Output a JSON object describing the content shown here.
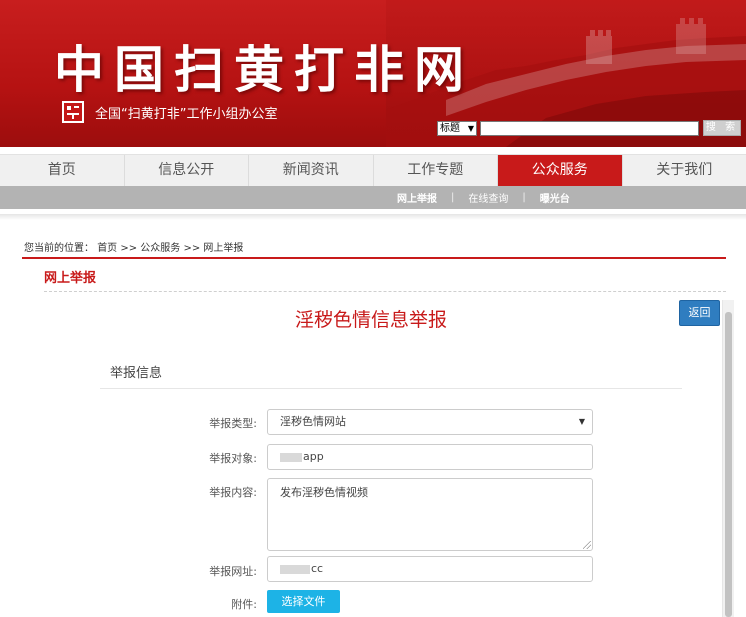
{
  "header": {
    "site_title": "中国扫黄打非网",
    "org_name": "全国“扫黄打非”工作小组办公室",
    "search": {
      "scope_value": "标题",
      "button_label": "搜 索"
    }
  },
  "nav": {
    "items": [
      {
        "label": "首页"
      },
      {
        "label": "信息公开"
      },
      {
        "label": "新闻资讯"
      },
      {
        "label": "工作专题"
      },
      {
        "label": "公众服务",
        "active": true
      },
      {
        "label": "关于我们"
      }
    ],
    "subnav": [
      {
        "label": "网上举报"
      },
      {
        "label": "在线查询"
      },
      {
        "label": "曝光台"
      }
    ]
  },
  "breadcrumb": {
    "prefix": "您当前的位置：",
    "path": "首页 >> 公众服务 >> 网上举报"
  },
  "section_heading": "网上举报",
  "form": {
    "title": "淫秽色情信息举报",
    "back_label": "返回",
    "legend": "举报信息",
    "fields": {
      "type": {
        "label": "举报类型:",
        "value": "淫秽色情网站"
      },
      "target": {
        "label": "举报对象:",
        "value": "app"
      },
      "content": {
        "label": "举报内容:",
        "value": "发布淫秽色情视频"
      },
      "url": {
        "label": "举报网址:",
        "value": "cc"
      },
      "attachment": {
        "label": "附件:",
        "button_label": "选择文件"
      }
    }
  },
  "colors": {
    "brand_red": "#c81a1a",
    "accent_blue": "#2f7dc0",
    "file_button": "#1db3e6"
  }
}
